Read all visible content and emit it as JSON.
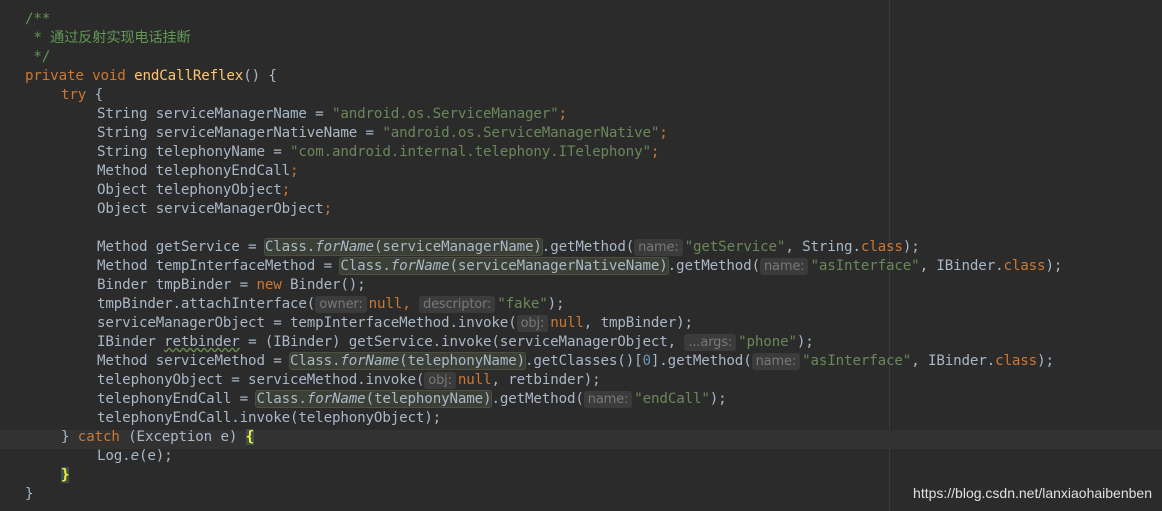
{
  "comment": {
    "open": "/**",
    "text": " * 通过反射实现电话挂断",
    "close": " */"
  },
  "code": {
    "l4_kw": "private void ",
    "l4_fn": "endCallReflex",
    "l4_rest": "() {",
    "l5_kw": "try",
    "l5_rest": " {",
    "l6_type": "String serviceManagerName = ",
    "l6_str": "\"android.os.ServiceManager\"",
    "l7_type": "String serviceManagerNativeName = ",
    "l7_str": "\"android.os.ServiceManagerNative\"",
    "l8_type": "String telephonyName = ",
    "l8_str": "\"com.android.internal.telephony.ITelephony\"",
    "l9": "Method telephonyEndCall",
    "l10": "Object telephonyObject",
    "l11": "Object serviceManagerObject",
    "semi": ";",
    "l13_a": "Method getService = ",
    "l13_hl": "Class.forName(serviceManagerName)",
    "l13_b": ".getMethod(",
    "l13_hint": "name:",
    "l13_str": "\"getService\"",
    "l13_c": ", String.",
    "l14_a": "Method tempInterfaceMethod = ",
    "l14_hl": "Class.forName(serviceManagerNativeName)",
    "l14_b": ".getMethod(",
    "l14_hint": "name:",
    "l14_str": "\"asInterface\"",
    "l14_c": ", IBinder.",
    "class_kw": "class",
    "close_paren": ");",
    "l15_a": "Binder tmpBinder = ",
    "l15_kw": "new",
    "l15_b": " Binder();",
    "l16_a": "tmpBinder.attachInterface(",
    "l16_hint1": "owner:",
    "null_kw": "null",
    "comma": ", ",
    "l16_hint2": "descriptor:",
    "l16_str": "\"fake\"",
    "l17_a": "serviceManagerObject = tempInterfaceMethod.invoke(",
    "l17_hint": "obj:",
    "l17_b": ", tmpBinder);",
    "l18_a": "IBinder ",
    "l18_var": "retbinder",
    "l18_b": " = (IBinder) getService.invoke(serviceManagerObject, ",
    "l18_hint": "...args:",
    "l18_str": "\"phone\"",
    "l19_a": "Method serviceMethod = ",
    "l19_hl": "Class.forName(telephonyName)",
    "l19_b": ".getClasses()[",
    "l19_num": "0",
    "l19_c": "].getMethod(",
    "l19_hint": "name:",
    "l19_str": "\"asInterface\"",
    "l19_d": ", IBinder.",
    "l20_a": "telephonyObject = serviceMethod.invoke(",
    "l20_hint": "obj:",
    "l20_b": ", retbinder);",
    "l21_a": "telephonyEndCall = ",
    "l21_hl": "Class.forName(telephonyName)",
    "l21_b": ".getMethod(",
    "l21_hint": "name:",
    "l21_str": "\"endCall\"",
    "l22": "telephonyEndCall.invoke(telephonyObject);",
    "l23_a": "} ",
    "l23_kw": "catch",
    "l23_b": " (Exception e) ",
    "open_brace": "{",
    "l24_a": "Log.",
    "l24_it": "e",
    "l24_b": "(e);",
    "close_brace": "}",
    "l26": "}"
  },
  "watermark": "https://blog.csdn.net/lanxiaohaibenben",
  "colors": {
    "background": "#2b2b2b",
    "keyword": "#cc7832",
    "string": "#6a8759",
    "comment": "#629755",
    "function": "#ffc66d",
    "text": "#a9b7c6"
  }
}
